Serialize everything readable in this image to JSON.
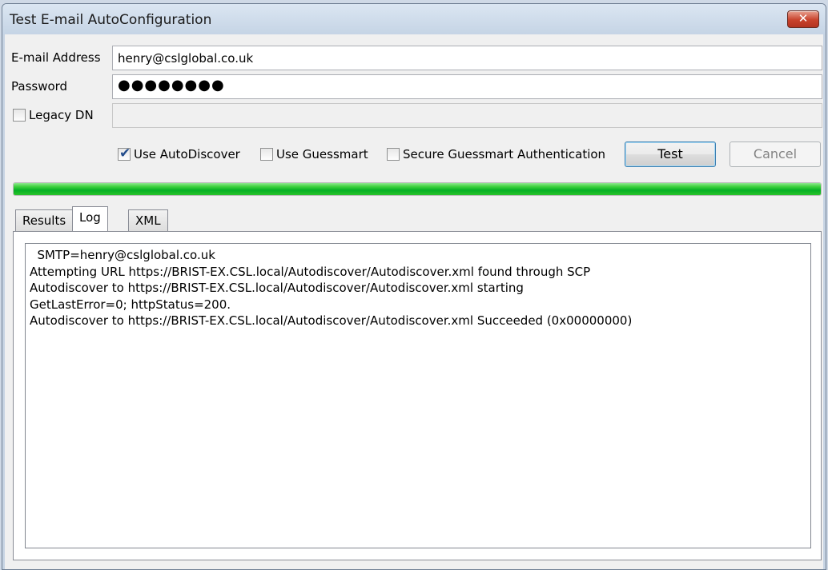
{
  "window": {
    "title": "Test E-mail AutoConfiguration",
    "close_icon": "close-icon",
    "close_glyph": "✕"
  },
  "form": {
    "email_label": "E-mail Address",
    "email_value": "henry@cslglobal.co.uk",
    "password_label": "Password",
    "password_value": "●●●●●●●●",
    "legacy_dn_label": "Legacy DN",
    "legacy_dn_checked": false,
    "legacy_dn_value": ""
  },
  "options": {
    "use_autodiscover": {
      "label": "Use AutoDiscover",
      "checked": true
    },
    "use_guessmart": {
      "label": "Use Guessmart",
      "checked": false
    },
    "secure_guessmart": {
      "label": "Secure Guessmart Authentication",
      "checked": false
    }
  },
  "buttons": {
    "test": "Test",
    "cancel": "Cancel"
  },
  "progress": {
    "percent": 100,
    "color": "#06b025"
  },
  "tabs": [
    {
      "label": "Results",
      "active": false
    },
    {
      "label": "Log",
      "active": true
    },
    {
      "label": "XML",
      "active": false
    }
  ],
  "log": {
    "lines": [
      "  SMTP=henry@cslglobal.co.uk",
      "Attempting URL https://BRIST-EX.CSL.local/Autodiscover/Autodiscover.xml found through SCP",
      "Autodiscover to https://BRIST-EX.CSL.local/Autodiscover/Autodiscover.xml starting",
      "GetLastError=0; httpStatus=200.",
      "Autodiscover to https://BRIST-EX.CSL.local/Autodiscover/Autodiscover.xml Succeeded (0x00000000)"
    ]
  }
}
